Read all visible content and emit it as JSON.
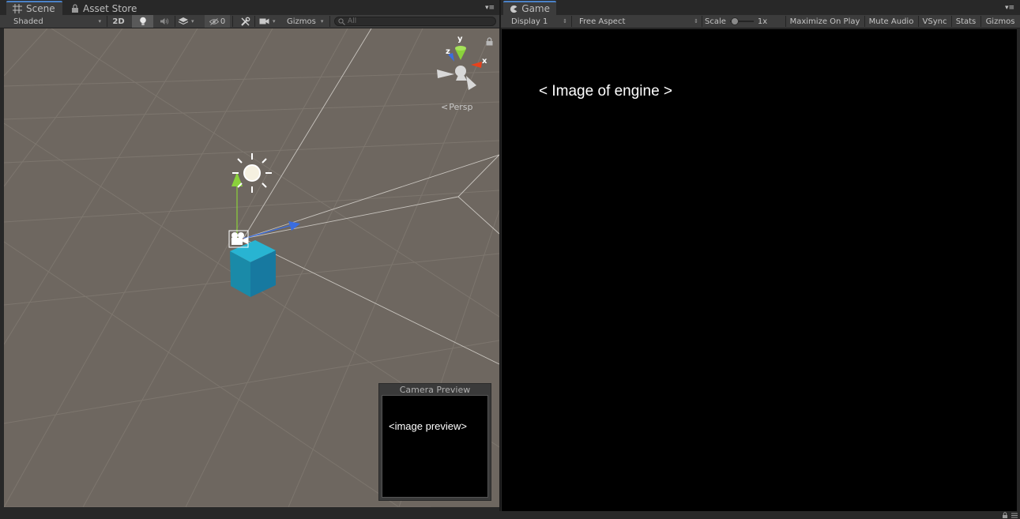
{
  "scene": {
    "tabs": [
      {
        "label": "Scene",
        "icon": "grid-icon",
        "active": true
      },
      {
        "label": "Asset Store",
        "icon": "lock-icon",
        "active": false
      }
    ],
    "toolbar": {
      "shading_mode": "Shaded",
      "mode_2d_label": "2D",
      "lighting_icon": "lightbulb-icon",
      "audio_icon": "speaker-icon",
      "effects_icon": "layers-icon",
      "hidden_count": "0",
      "tools_icon": "wrench-icon",
      "camera_icon": "camera-icon",
      "gizmos_label": "Gizmos",
      "search_placeholder": "All"
    },
    "viewport": {
      "projection_label": "Persp",
      "gizmo_axes": [
        "y",
        "z",
        "x"
      ],
      "camera_preview": {
        "title": "Camera Preview",
        "image_label": "<image preview>"
      }
    }
  },
  "game": {
    "tabs": [
      {
        "label": "Game",
        "icon": "pacman-icon",
        "active": true
      }
    ],
    "toolbar": {
      "display": "Display 1",
      "aspect": "Free Aspect",
      "scale_label": "Scale",
      "scale_value": "1x",
      "scale_level": 0.05,
      "maximize_on_play": "Maximize On Play",
      "mute_audio": "Mute Audio",
      "vsync": "VSync",
      "stats": "Stats",
      "gizmos": "Gizmos"
    },
    "view": {
      "image_label": "< Image of engine >"
    }
  },
  "colors": {
    "scene_background": "#6e6760",
    "toolbar": "#3c3c3c",
    "tab_accent": "#4b82c8",
    "cube": "#1d93b0",
    "axis_x": "#e8421c",
    "axis_y": "#8ad13b",
    "axis_z": "#3a6de0",
    "game_background": "#000000"
  }
}
